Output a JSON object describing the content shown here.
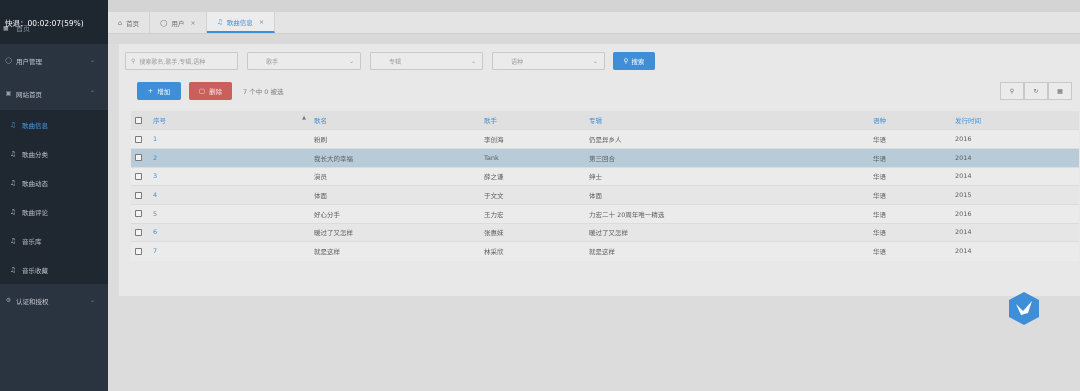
{
  "overlay": {
    "status": "快退：00:02:07(59%)"
  },
  "sidebar": {
    "home": "首页",
    "items": [
      {
        "label": "用户管理",
        "icon": "user-icon"
      },
      {
        "label": "网站首页",
        "icon": "home-icon"
      }
    ],
    "subitems": [
      {
        "label": "歌曲信息",
        "active": true
      },
      {
        "label": "歌曲分类"
      },
      {
        "label": "歌曲动态"
      },
      {
        "label": "歌曲评论"
      },
      {
        "label": "音乐库"
      },
      {
        "label": "音乐收藏"
      }
    ],
    "auth": "认证和授权"
  },
  "tabs": [
    {
      "label": "首页",
      "icon": "home-icon"
    },
    {
      "label": "用户",
      "icon": "user-icon"
    },
    {
      "label": "歌曲信息",
      "icon": "music-icon",
      "active": true
    }
  ],
  "filters": {
    "search_placeholder": "搜索歌名,歌手,专辑,语种",
    "singer_placeholder": "歌手",
    "album_placeholder": "专辑",
    "language_placeholder": "语种",
    "search_label": "搜索"
  },
  "actions": {
    "add_label": "增加",
    "delete_label": "删除",
    "selection_info": "7 个中 0 被选"
  },
  "table": {
    "columns": [
      "序号",
      "歌名",
      "歌手",
      "专辑",
      "语种",
      "发行时间"
    ],
    "rows": [
      [
        "1",
        "粉刷",
        "李创海",
        "仍是异乡人",
        "华语",
        "2016"
      ],
      [
        "2",
        "我长大的幸福",
        "Tank",
        "第三回合",
        "华语",
        "2014"
      ],
      [
        "3",
        "演员",
        "薛之谦",
        "绅士",
        "华语",
        "2014"
      ],
      [
        "4",
        "体面",
        "于文文",
        "体面",
        "华语",
        "2015"
      ],
      [
        "5",
        "好心分手",
        "王力宏",
        "力宏二十 20周年唯一精选",
        "华语",
        "2016"
      ],
      [
        "6",
        "暖过了又怎样",
        "张惠妹",
        "暖过了又怎样",
        "华语",
        "2014"
      ],
      [
        "7",
        "就是这样",
        "林采欣",
        "就是这样",
        "华语",
        "2014"
      ]
    ]
  },
  "colors": {
    "accent": "#3f8fd8",
    "danger": "#c9605c",
    "sidebar": "#2a3340",
    "selected_row": "#b8cbd8"
  }
}
